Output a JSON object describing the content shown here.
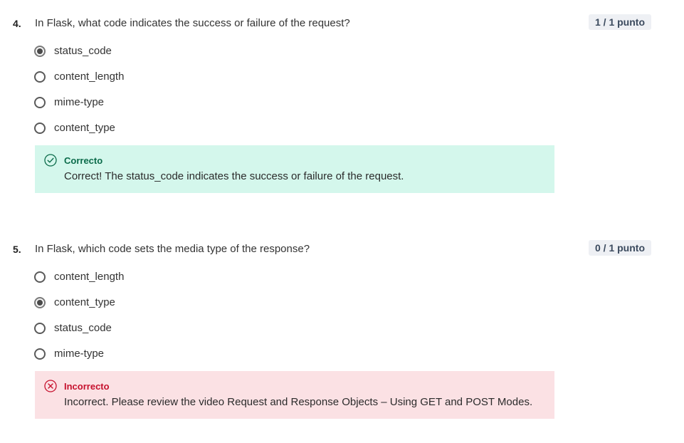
{
  "questions": [
    {
      "number": "4.",
      "text": "In Flask, what code indicates the success or failure of the request?",
      "points": "1 / 1 punto",
      "options": [
        {
          "label": "status_code",
          "selected": true
        },
        {
          "label": "content_length",
          "selected": false
        },
        {
          "label": "mime-type",
          "selected": false
        },
        {
          "label": "content_type",
          "selected": false
        }
      ],
      "feedback": {
        "status": "correct",
        "title": "Correcto",
        "text": "Correct! The status_code indicates the success or failure of the request.",
        "icon": "check-circle-icon"
      }
    },
    {
      "number": "5.",
      "text": "In Flask, which code sets the media type of the response?",
      "points": "0 / 1 punto",
      "options": [
        {
          "label": "content_length",
          "selected": false
        },
        {
          "label": "content_type",
          "selected": true
        },
        {
          "label": "status_code",
          "selected": false
        },
        {
          "label": "mime-type",
          "selected": false
        }
      ],
      "feedback": {
        "status": "incorrect",
        "title": "Incorrecto",
        "text": "Incorrect. Please review the video Request and Response Objects – Using GET and POST Modes.",
        "icon": "x-circle-icon"
      }
    }
  ],
  "colors": {
    "correct_bg": "#d4f7ec",
    "correct_accent": "#0b6b4a",
    "incorrect_bg": "#fbe1e4",
    "incorrect_accent": "#c6102d",
    "badge_bg": "#eef0f4"
  }
}
